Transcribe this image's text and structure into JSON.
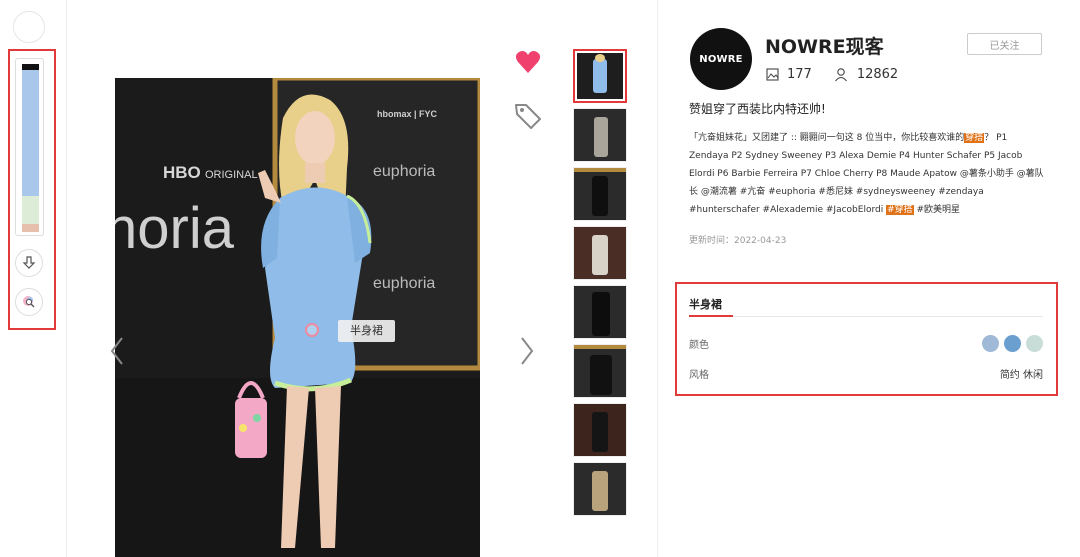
{
  "author": {
    "name": "NOWRE现客",
    "avatar_text": "NOWRE",
    "follow_label": "已关注",
    "images_count": "177",
    "followers_count": "12862"
  },
  "post": {
    "title": "赞姐穿了西装比内特还帅!",
    "body_1": "「亢奋姐妹花」又团建了 :: 翾翾问一句这 8 位当中，你比较喜欢谁的",
    "body_hl_1": "穿搭",
    "body_2": "？ P1 Zendaya P2 Sydney Sweeney P3 Alexa Demie P4 Hunter Schafer P5 Jacob Elordi P6 Barbie Ferreira P7 Chloe Cherry P8 Maude Apatow @薯条小助手 @薯队长 @潮流薯 #亢奋 #euphoria #悉尼妹 #sydneysweeney #zendaya #hunterschafer #Alexademie #JacobElordi ",
    "body_hl_2": "#穿搭",
    "body_3": " #欧美明星",
    "updated": "更新时间：2022-04-23"
  },
  "photo": {
    "tag_label": "半身裙",
    "bg_text_1": "euphoria",
    "bg_text_2": "HBO",
    "bg_text_3": "ORIGINAL",
    "bg_text_4": "hbomax | FYC"
  },
  "attributes": {
    "title": "半身裙",
    "color_label": "颜色",
    "style_label": "风格",
    "style_value": "简约 休闲",
    "colors": [
      "#9fb9d6",
      "#6a9fd0",
      "#c9ddd8"
    ]
  },
  "palette_colors": [
    "#111111",
    "#a9c7ea",
    "#dcecd6",
    "#e6c0ad"
  ],
  "thumbnails": [
    "P1",
    "P2",
    "P3",
    "P4",
    "P5",
    "P6",
    "P7",
    "P8"
  ]
}
